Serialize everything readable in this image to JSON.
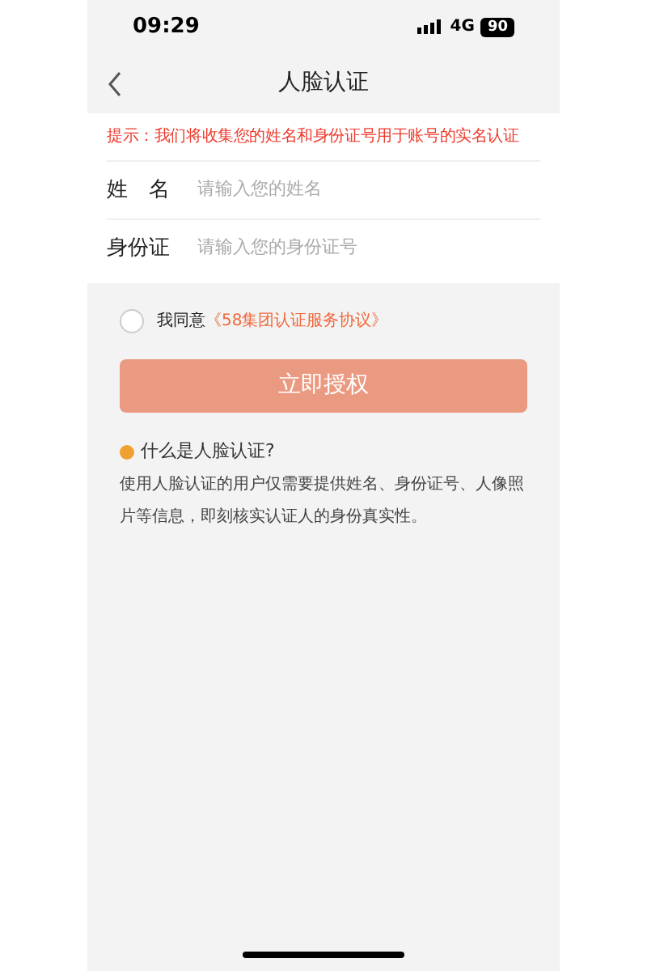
{
  "status_bar": {
    "time": "09:29",
    "network": "4G",
    "battery": "90"
  },
  "nav": {
    "title": "人脸认证"
  },
  "notice": "提示：我们将收集您的姓名和身份证号用于账号的实名认证",
  "fields": [
    {
      "label": "姓　名",
      "placeholder": "请输入您的姓名"
    },
    {
      "label": "身份证",
      "placeholder": "请输入您的身份证号"
    }
  ],
  "agreement": {
    "checked": false,
    "text": "我同意",
    "link": "《58集团认证服务协议》"
  },
  "submit": {
    "label": "立即授权",
    "disabled": true
  },
  "help": {
    "question": "什么是人脸认证?",
    "answer": "使用人脸认证的用户仅需要提供姓名、身份证号、人像照片等信息，即刻核实认证人的身份真实性。"
  }
}
